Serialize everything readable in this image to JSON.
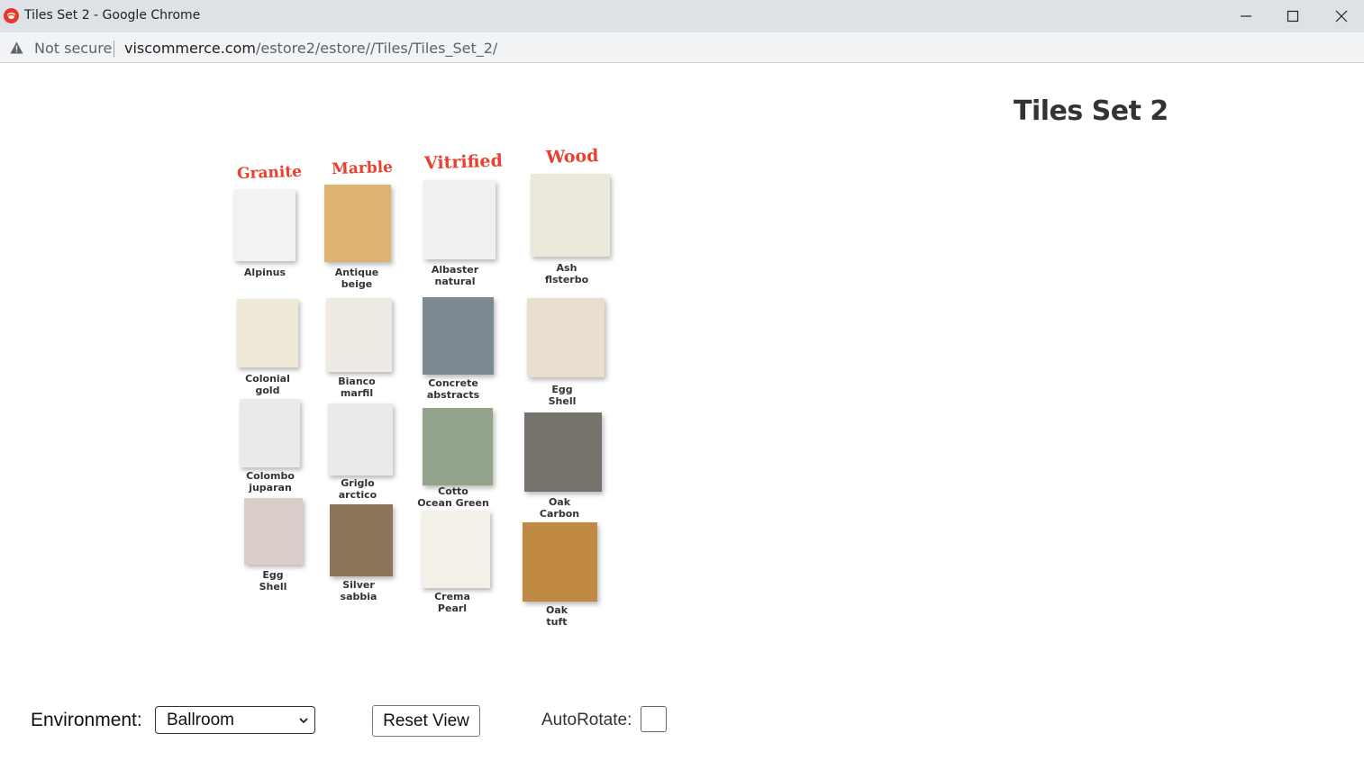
{
  "window": {
    "title": "Tiles Set 2 - Google Chrome",
    "favicon": "viscommerce-icon"
  },
  "addressbar": {
    "security": "Not secure",
    "url_host": "viscommerce.com",
    "url_path": "/estore2/estore//Tiles/Tiles_Set_2/"
  },
  "page": {
    "title": "Tiles Set 2"
  },
  "categories": [
    "Granite",
    "Marble",
    "Vitrified",
    "Wood"
  ],
  "tiles": [
    {
      "label": "Alpinus",
      "color": "#f2f2f2"
    },
    {
      "label": "Antique\nbeige",
      "color": "#deb470"
    },
    {
      "label": "Albaster\nnatural",
      "color": "#f1f1f0"
    },
    {
      "label": "Ash\nflsterbo",
      "color": "#ece8dc"
    },
    {
      "label": "Colonial\ngold",
      "color": "#efead8"
    },
    {
      "label": "Bianco\nmarfil",
      "color": "#efebe4"
    },
    {
      "label": "Concrete\nabstracts",
      "color": "#7d8a92"
    },
    {
      "label": "Egg\nShell",
      "color": "#e8dfcf"
    },
    {
      "label": "Colombo\njuparan",
      "color": "#eaeaea"
    },
    {
      "label": "Griglo\narctico",
      "color": "#e9eaeb"
    },
    {
      "label": "Cotto\nOcean Green",
      "color": "#93a48c"
    },
    {
      "label": "Oak\nCarbon",
      "color": "#76726c"
    },
    {
      "label": "Egg\nShell",
      "color": "#d9cfc8"
    },
    {
      "label": "Silver\nsabbia",
      "color": "#8b7457"
    },
    {
      "label": "Crema\nPearl",
      "color": "#f3f0e8"
    },
    {
      "label": "Oak\ntuft",
      "color": "#c08a45"
    }
  ],
  "controls": {
    "environment_label": "Environment:",
    "environment_value": "Ballroom",
    "reset_label": "Reset View",
    "autorotate_label": "AutoRotate:",
    "autorotate_checked": false
  },
  "colors": {
    "category_text": "#e8412e",
    "titlebar_bg": "#dee1e6"
  }
}
